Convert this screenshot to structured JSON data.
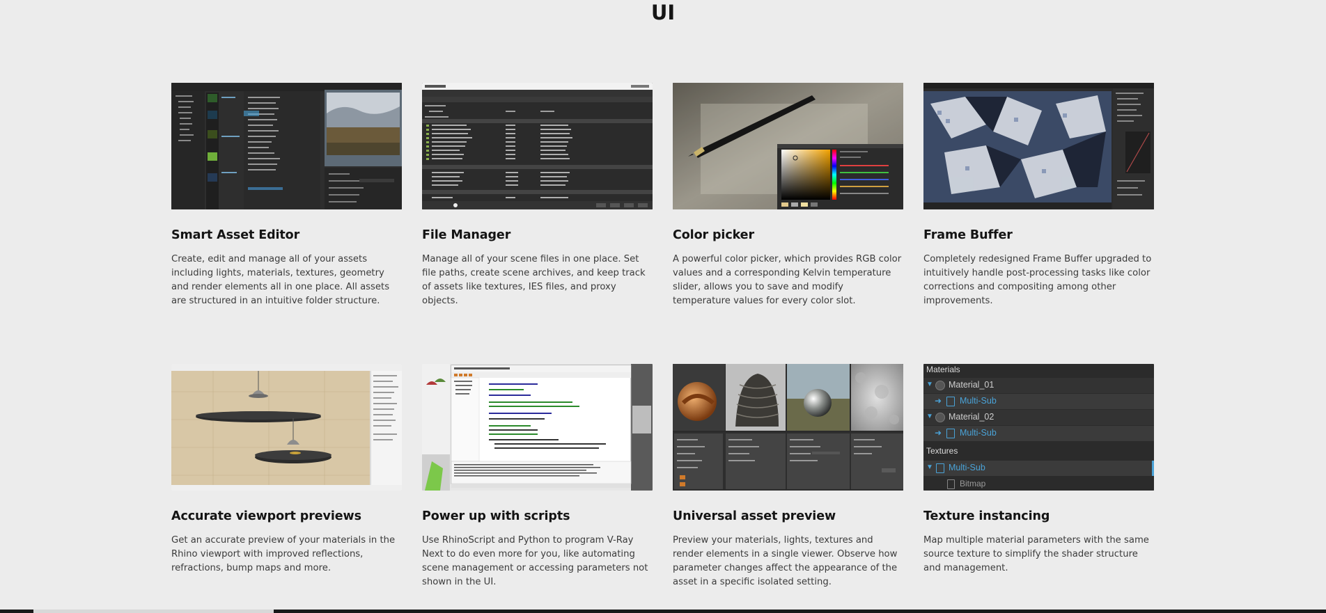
{
  "page": {
    "title": "UI"
  },
  "cards": [
    {
      "title": "Smart Asset Editor",
      "description": "Create, edit and manage all of your assets including lights, materials, textures, geometry and render elements all in one place. All assets are structured in an intuitive folder structure."
    },
    {
      "title": "File Manager",
      "description": "Manage all of your scene files in one place. Set file paths, create scene archives, and keep track of assets like textures, IES files, and proxy objects."
    },
    {
      "title": "Color picker",
      "description": "A powerful color picker, which provides RGB color values and a corresponding Kelvin temperature slider, allows you to save and modify temperature values for every color slot."
    },
    {
      "title": "Frame Buffer",
      "description": "Completely redesigned Frame Buffer upgraded to intuitively handle post-processing tasks like color corrections and compositing among other improvements."
    },
    {
      "title": "Accurate viewport previews",
      "description": "Get an accurate preview of your materials in the Rhino viewport with improved reflections, refractions, bump maps and more."
    },
    {
      "title": "Power up with scripts",
      "description": "Use RhinoScript and Python to program V-Ray Next to do even more for you, like automating scene management or accessing parameters not shown in the UI."
    },
    {
      "title": "Universal asset preview",
      "description": "Preview your materials, lights, textures and render elements in a single viewer. Observe how parameter changes affect the appearance of the asset in a specific isolated setting."
    },
    {
      "title": "Texture instancing",
      "description": "Map multiple material parameters with the same source texture to simplify the shader structure and management."
    }
  ],
  "texture_instancing_panel": {
    "materials_header": "Materials",
    "material_01": "Material_01",
    "material_01_sub": "Multi-Sub",
    "material_02": "Material_02",
    "material_02_sub": "Multi-Sub",
    "textures_header": "Textures",
    "texture_sub": "Multi-Sub",
    "texture_bitmap": "Bitmap"
  },
  "colors": {
    "background": "#ececec",
    "accent_blue": "#4aa3d8",
    "panel_dark": "#2b2b2b"
  }
}
